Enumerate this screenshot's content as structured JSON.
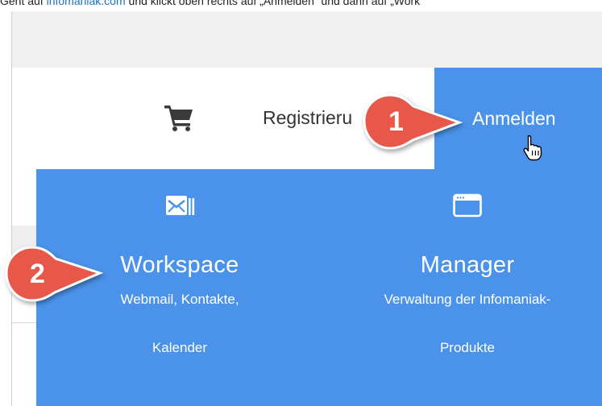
{
  "caption": {
    "pre": "Geht auf ",
    "link": "infomaniak.com",
    "post": " und klickt oben rechts auf „Anmelden“ und dann auf „Work"
  },
  "header": {
    "cart_icon": "cart-icon",
    "register_label": "Registrieru",
    "login_label": "Anmelden"
  },
  "menu": {
    "workspace": {
      "icon": "mail-icon",
      "title": "Workspace",
      "subtitle_line1": "Webmail, Kontakte,",
      "subtitle_line2": "Kalender"
    },
    "manager": {
      "icon": "browser-window-icon",
      "title": "Manager",
      "subtitle_line1": "Verwaltung der Infomaniak-",
      "subtitle_line2": "Produkte"
    }
  },
  "callouts": [
    {
      "label": "1",
      "color": "#e8584a"
    },
    {
      "label": "2",
      "color": "#e8584a"
    }
  ],
  "colors": {
    "accent_blue": "#4b93ea",
    "callout_red": "#e8584a",
    "link_blue": "#1a73c7"
  }
}
